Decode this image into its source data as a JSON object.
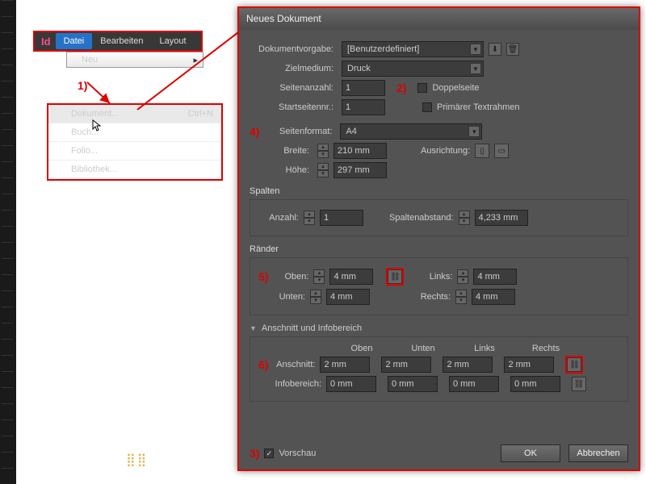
{
  "menubar": {
    "items": [
      "Datei",
      "Bearbeiten",
      "Layout"
    ],
    "selected": 0
  },
  "flyout": {
    "label": "Neu"
  },
  "submenu": {
    "items": [
      {
        "label": "Dokument...",
        "shortcut": "Ctrl+N"
      },
      {
        "label": "Buch..."
      },
      {
        "label": "Folio..."
      },
      {
        "label": "Bibliothek..."
      }
    ]
  },
  "annotations": {
    "a1": "1)",
    "a2": "2)",
    "a3": "3)",
    "a4": "4)",
    "a5": "5)",
    "a6": "6)"
  },
  "dialog": {
    "title": "Neues Dokument",
    "preset_label": "Dokumentvorgabe:",
    "preset_value": "[Benutzerdefiniert]",
    "intent_label": "Zielmedium:",
    "intent_value": "Druck",
    "pages_label": "Seitenanzahl:",
    "pages_value": "1",
    "facing_label": "Doppelseite",
    "facing_checked": false,
    "start_label": "Startseitennr.:",
    "start_value": "1",
    "primary_label": "Primärer Textrahmen",
    "primary_checked": false,
    "size_label": "Seitenformat:",
    "size_value": "A4",
    "width_label": "Breite:",
    "width_value": "210 mm",
    "height_label": "Höhe:",
    "height_value": "297 mm",
    "orient_label": "Ausrichtung:",
    "columns_title": "Spalten",
    "col_count_label": "Anzahl:",
    "col_count_value": "1",
    "gutter_label": "Spaltenabstand:",
    "gutter_value": "4,233 mm",
    "margins_title": "Ränder",
    "m_top_label": "Oben:",
    "m_top": "4 mm",
    "m_bot_label": "Unten:",
    "m_bot": "4 mm",
    "m_left_label": "Links:",
    "m_left": "4 mm",
    "m_right_label": "Rechts:",
    "m_right": "4 mm",
    "bleed_title": "Anschnitt und Infobereich",
    "col_hdr": {
      "top": "Oben",
      "bot": "Unten",
      "left": "Links",
      "right": "Rechts"
    },
    "bleed_label": "Anschnitt:",
    "bleed": {
      "t": "2 mm",
      "b": "2 mm",
      "l": "2 mm",
      "r": "2 mm"
    },
    "slug_label": "Infobereich:",
    "slug": {
      "t": "0 mm",
      "b": "0 mm",
      "l": "0 mm",
      "r": "0 mm"
    },
    "preview_label": "Vorschau",
    "preview_checked": true,
    "ok": "OK",
    "cancel": "Abbrechen"
  }
}
